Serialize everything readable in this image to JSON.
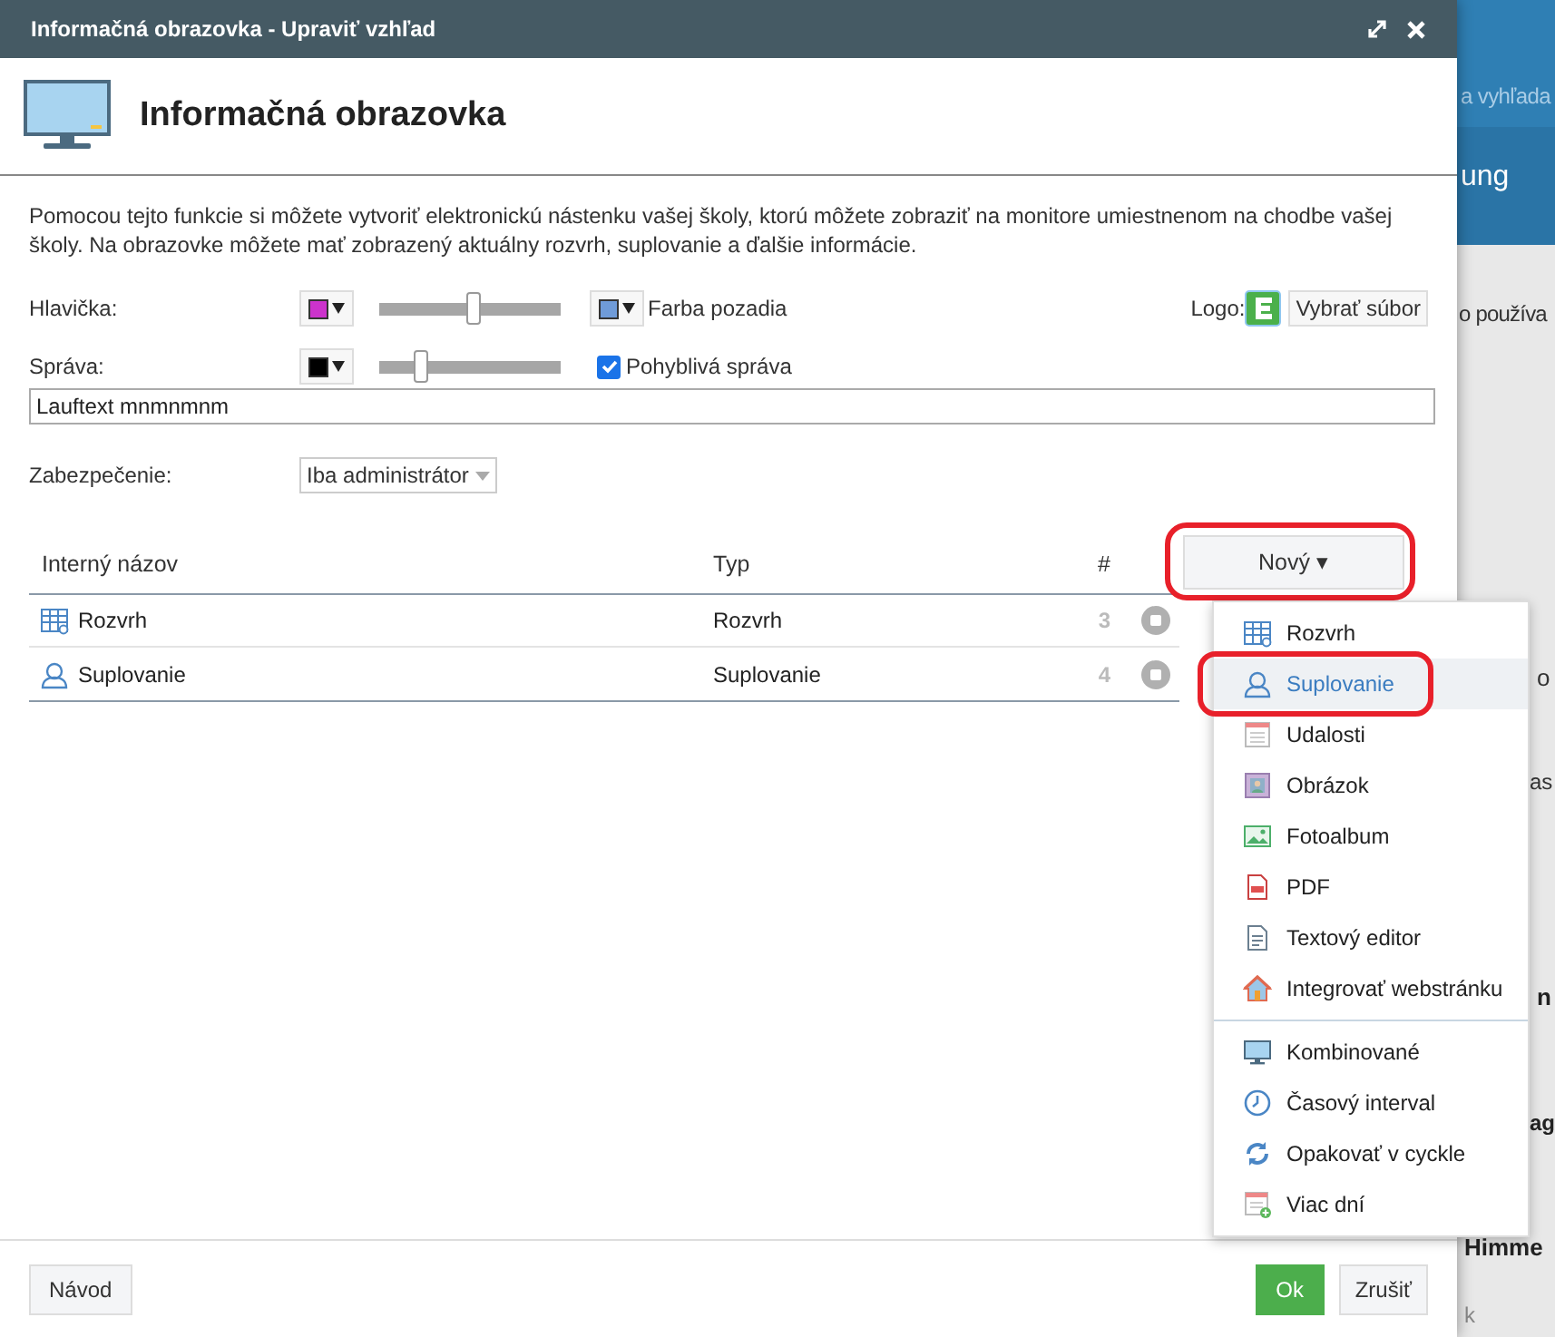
{
  "background": {
    "search_placeholder": "a vyhľada",
    "texts": [
      "ung",
      "o používa",
      "o",
      "as",
      "n",
      "ag",
      "Himme",
      "k"
    ]
  },
  "window": {
    "title": "Informačná obrazovka - Upraviť vzhľad"
  },
  "heading": "Informačná obrazovka",
  "description": "Pomocou tejto funkcie si môžete vytvoriť elektronickú nástenku vašej školy, ktorú môžete zobraziť na monitore umiestnenom na chodbe vašej školy. Na obrazovke môžete mať zobrazený aktuálny rozvrh, suplovanie a ďalšie informácie.",
  "header_row": {
    "label": "Hlavička:",
    "swatch": {
      "color": "#cc33cc"
    },
    "level": 0.52,
    "bg_swatch": {
      "color": "#6f9bd8"
    },
    "bg_label": "Farba pozadia",
    "logo_label": "Logo:",
    "file_button": "Vybrať súbor"
  },
  "message_row": {
    "label": "Správa:",
    "swatch": {
      "color": "#000000"
    },
    "level": 0.23,
    "moving_checked": true,
    "moving_label": "Pohyblivá správa",
    "text": "Lauftext mnmnmnm"
  },
  "security": {
    "label": "Zabezpečenie:",
    "value": "Iba administrátor"
  },
  "table": {
    "columns": [
      "Interný názov",
      "Typ",
      "#"
    ],
    "rows": [
      {
        "kind": "timetable",
        "name": "Rozvrh",
        "type": "Rozvrh",
        "number": "3"
      },
      {
        "kind": "substitution",
        "name": "Suplovanie",
        "type": "Suplovanie",
        "number": "4"
      }
    ]
  },
  "new_button": {
    "label": "Nový ▾"
  },
  "menu": {
    "groups": [
      [
        {
          "kind": "timetable",
          "label": "Rozvrh",
          "selected": false
        },
        {
          "kind": "substitution",
          "label": "Suplovanie",
          "selected": true
        },
        {
          "kind": "events",
          "label": "Udalosti",
          "selected": false
        },
        {
          "kind": "image",
          "label": "Obrázok",
          "selected": false
        },
        {
          "kind": "album",
          "label": "Fotoalbum",
          "selected": false
        },
        {
          "kind": "pdf",
          "label": "PDF",
          "selected": false
        },
        {
          "kind": "text",
          "label": "Textový editor",
          "selected": false
        },
        {
          "kind": "web",
          "label": "Integrovať webstránku",
          "selected": false
        }
      ],
      [
        {
          "kind": "combined",
          "label": "Kombinované",
          "selected": false
        },
        {
          "kind": "interval",
          "label": "Časový interval",
          "selected": false
        },
        {
          "kind": "cycle",
          "label": "Opakovať v cyckle",
          "selected": false
        },
        {
          "kind": "days",
          "label": "Viac dní",
          "selected": false
        }
      ]
    ]
  },
  "footer": {
    "help_button": "Návod",
    "ok_button": "Ok",
    "cancel_button": "Zrušiť"
  }
}
